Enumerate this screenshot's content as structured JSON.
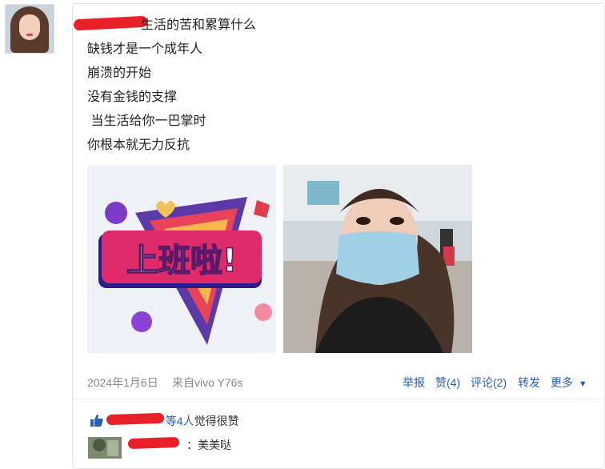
{
  "post": {
    "lines": [
      "生活的苦和累算什么",
      "缺钱才是一个成年人",
      "崩溃的开始",
      "没有金钱的支撑",
      " 当生活给你一巴掌时",
      "你根本就无力反抗"
    ],
    "image1_text": "上班啦!"
  },
  "meta": {
    "date": "2024年1月6日",
    "source": "来自vivo Y76s"
  },
  "actions": {
    "report": "举报",
    "like": "赞(4)",
    "comment": "评论(2)",
    "forward": "转发",
    "more": "更多"
  },
  "likes": {
    "count": "等4人",
    "suffix": "觉得很赞"
  },
  "comment": {
    "text": "：美美哒"
  },
  "colors": {
    "link": "#2a5db0",
    "redaction": "#e8202a"
  }
}
